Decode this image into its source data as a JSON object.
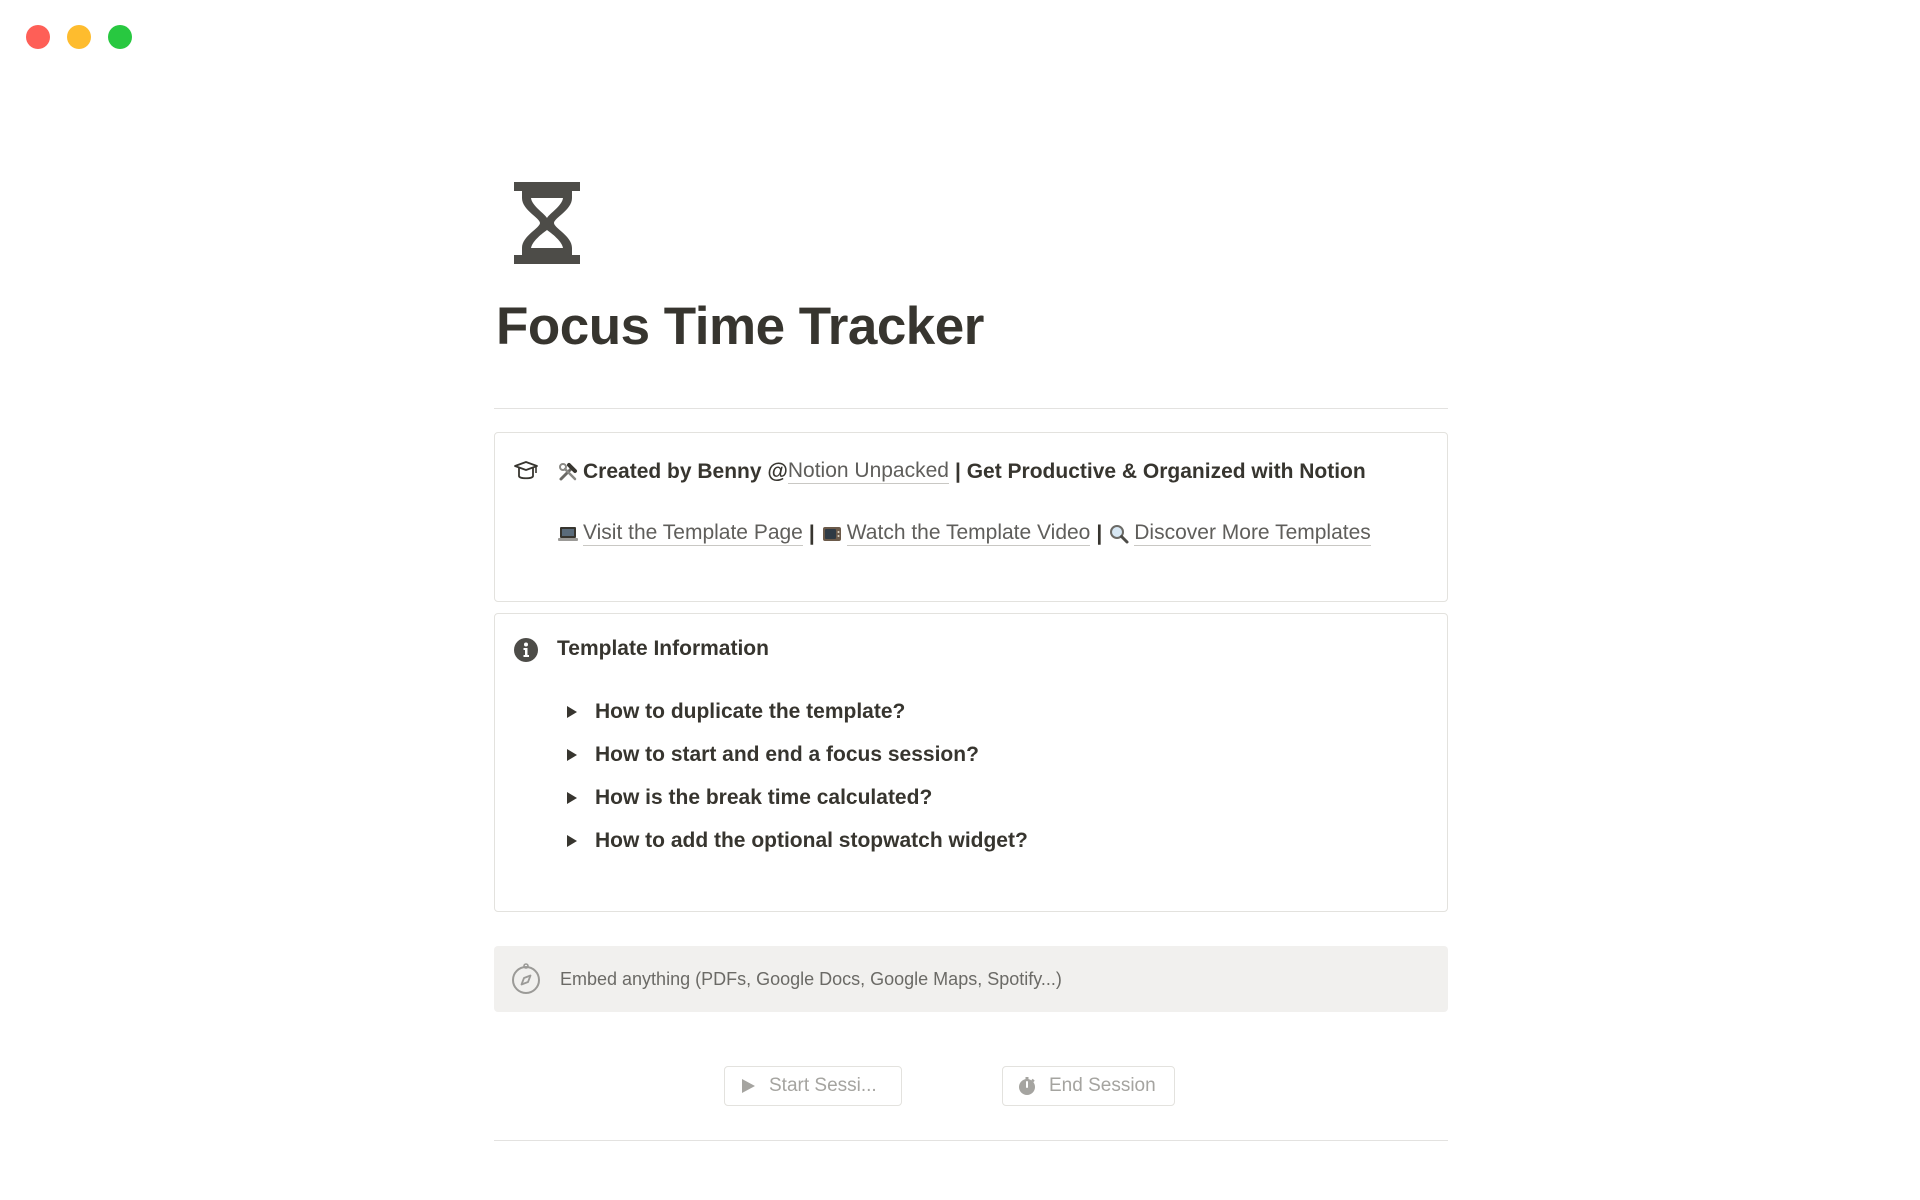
{
  "window": {
    "controls": {
      "close_color": "#fe5f57",
      "minimize_color": "#febc2e",
      "maximize_color": "#28c840"
    }
  },
  "page": {
    "icon": "hourglass-icon",
    "title": "Focus Time Tracker"
  },
  "credit_callout": {
    "icon": "mortarboard-icon",
    "line1": {
      "emoji": "hammer-and-wrench-icon",
      "prefix": "Created by Benny @ ",
      "link": "Notion Unpacked",
      "suffix": "| Get Productive & Organized with Notion"
    },
    "line2": {
      "links": [
        {
          "emoji": "laptop-icon",
          "label": "Visit the Template Page"
        },
        {
          "emoji": "television-icon",
          "label": "Watch the Template Video"
        },
        {
          "emoji": "magnifier-icon",
          "label": "Discover More Templates"
        }
      ],
      "separator": "|"
    }
  },
  "info_callout": {
    "icon": "info-icon",
    "heading": "Template Information",
    "toggles": [
      "How to duplicate the template?",
      "How to start and end a focus session?",
      "How is the break time calculated?",
      "How to add the optional stopwatch widget?"
    ]
  },
  "embed": {
    "icon": "compass-icon",
    "placeholder": "Embed anything (PDFs, Google Docs, Google Maps, Spotify...)"
  },
  "buttons": {
    "start": {
      "icon": "play-icon",
      "label": "Start Sessi..."
    },
    "end": {
      "icon": "stopwatch-icon",
      "label": "End Session"
    }
  }
}
